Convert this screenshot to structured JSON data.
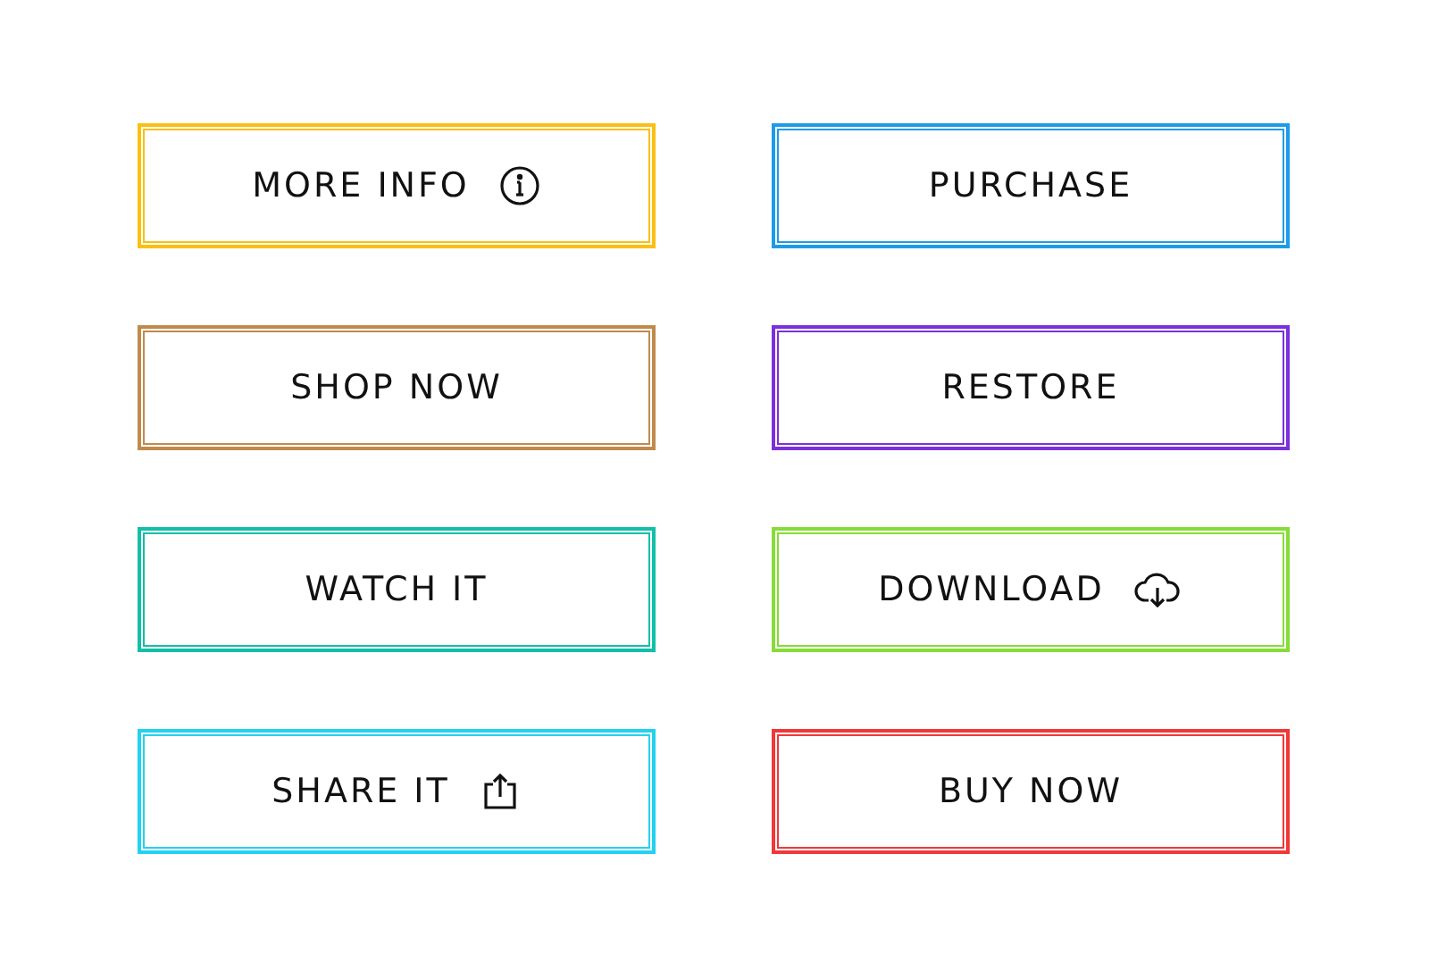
{
  "buttons": [
    {
      "label": "MORE INFO",
      "kind": "info",
      "color": "#fbbf12"
    },
    {
      "label": "PURCHASE",
      "kind": "plain",
      "color": "#1e9be8"
    },
    {
      "label": "SHOP NOW",
      "kind": "plain",
      "color": "#c08a4c"
    },
    {
      "label": "RESTORE",
      "kind": "plain",
      "color": "#7a30dc"
    },
    {
      "label": "WATCH IT",
      "kind": "plain",
      "color": "#12bfa8"
    },
    {
      "label": "DOWNLOAD",
      "kind": "download",
      "color": "#86dc38"
    },
    {
      "label": "SHARE IT",
      "kind": "share",
      "color": "#22d2f0"
    },
    {
      "label": "BUY NOW",
      "kind": "plain",
      "color": "#f03838"
    }
  ]
}
